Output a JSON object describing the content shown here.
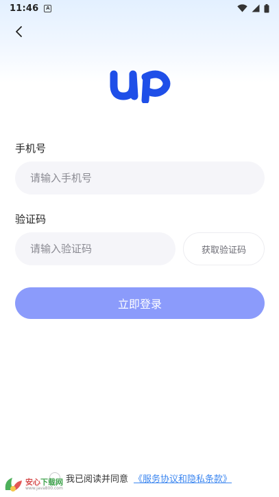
{
  "status_bar": {
    "time": "11:46",
    "notification_icon_letter": "A"
  },
  "form": {
    "phone_label": "手机号",
    "phone_placeholder": "请输入手机号",
    "phone_value": "",
    "code_label": "验证码",
    "code_placeholder": "请输入验证码",
    "code_value": "",
    "get_code_label": "获取验证码",
    "login_label": "立即登录"
  },
  "agreement": {
    "text": "我已阅读并同意",
    "link": "《服务协议和隐私条款》",
    "checked": false
  },
  "colors": {
    "logo": "#1f4fe8",
    "login_button": "#8b9bfb",
    "link": "#3b86f0",
    "input_bg": "#f5f5f9"
  },
  "icons": {
    "back": "chevron-left-icon",
    "wifi": "wifi-icon",
    "signal": "cellular-signal-icon",
    "battery": "battery-icon"
  }
}
